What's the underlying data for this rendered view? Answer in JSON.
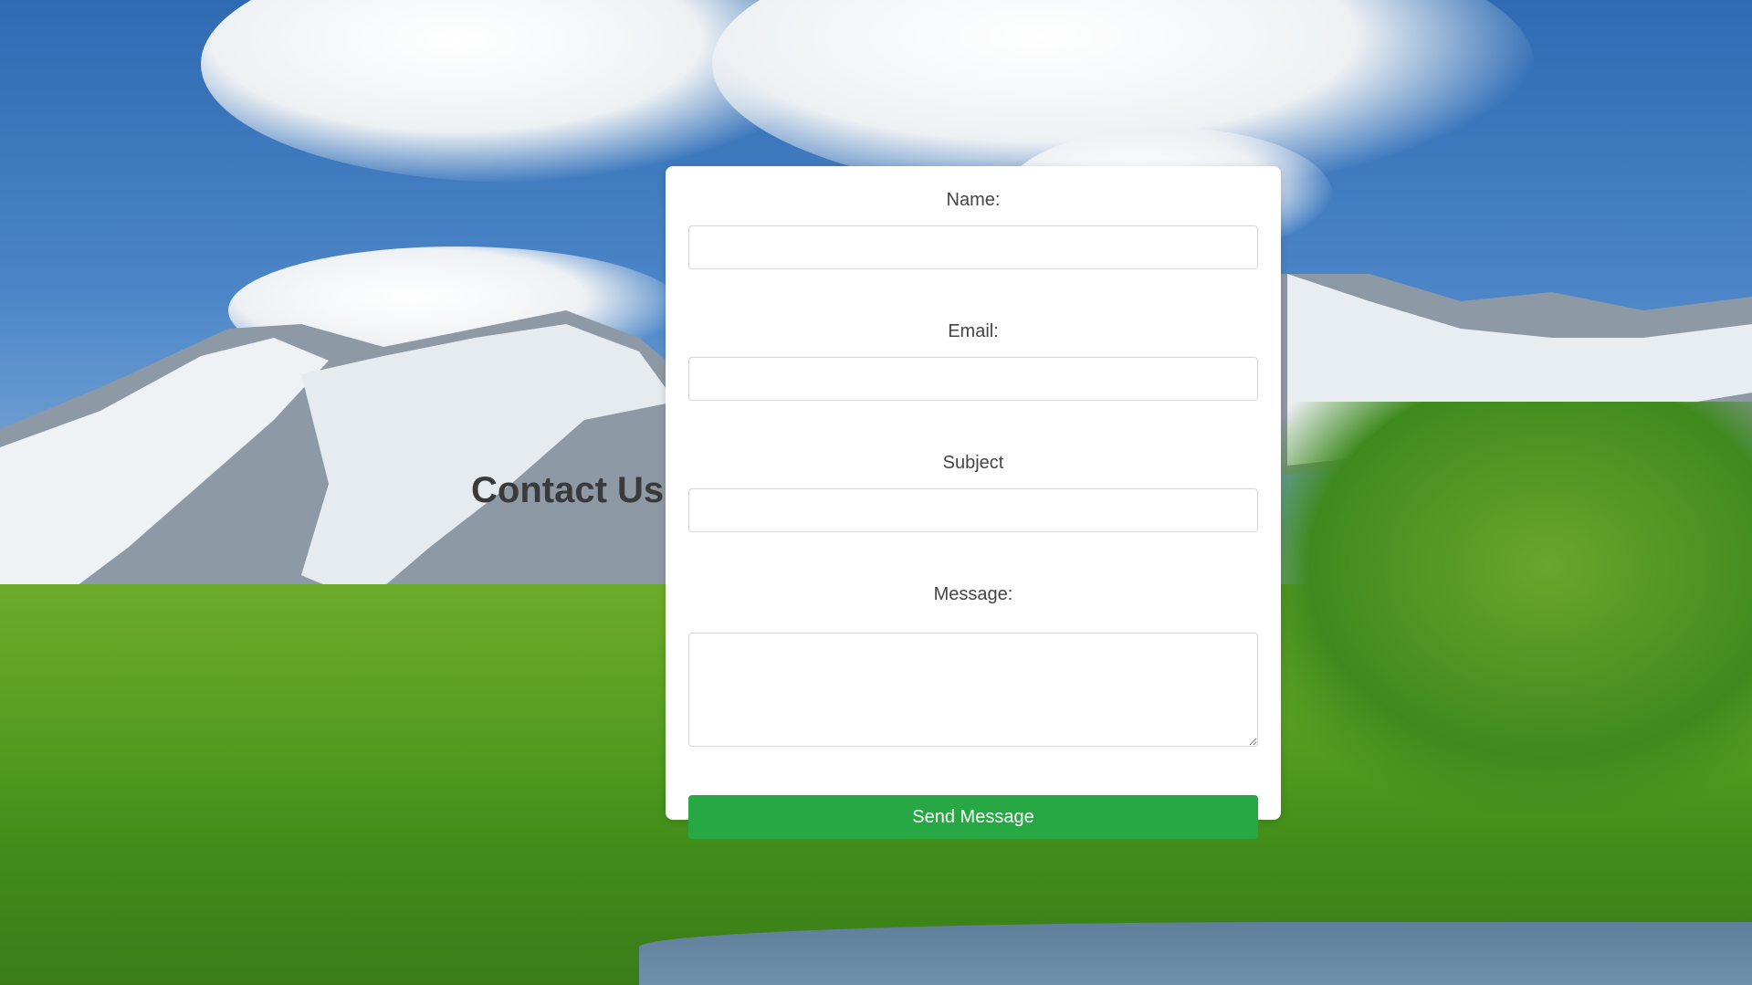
{
  "page": {
    "heading": "Contact Us"
  },
  "form": {
    "name_label": "Name:",
    "name_value": "",
    "email_label": "Email:",
    "email_value": "",
    "subject_label": "Subject",
    "subject_value": "",
    "message_label": "Message:",
    "message_value": "",
    "submit_label": "Send Message"
  },
  "colors": {
    "submit_button": "#28a745",
    "card_background": "#ffffff",
    "heading_text": "#3a3a3a"
  }
}
